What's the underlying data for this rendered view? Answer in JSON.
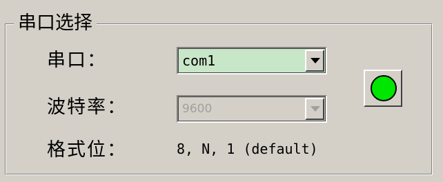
{
  "group": {
    "title": "串口选择"
  },
  "port": {
    "label": "串口：",
    "value": "com1"
  },
  "baud": {
    "label": "波特率：",
    "value": "9600"
  },
  "format": {
    "label": "格式位：",
    "value": "8, N, 1 (default)"
  },
  "status": {
    "led_color": "#00e600"
  }
}
